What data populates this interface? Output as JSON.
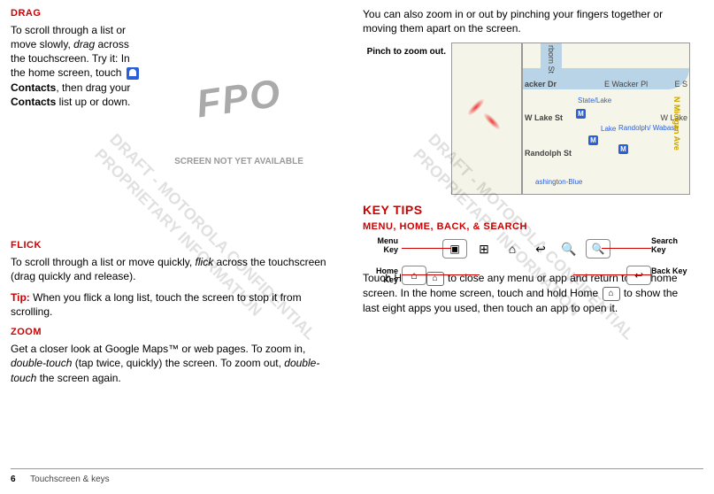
{
  "left": {
    "drag_h": "DRAG",
    "drag_p1a": "To scroll through a list or move slowly, ",
    "drag_p1b": "drag",
    "drag_p1c": " across the touchscreen. Try it: In the home screen, touch ",
    "drag_p1d": "Contacts",
    "drag_p1e": ", then drag your ",
    "drag_p1f": "Contacts",
    "drag_p1g": " list up or down.",
    "fpo": "FPO",
    "fpo_sub": "SCREEN NOT YET AVAILABLE",
    "flick_h": "FLICK",
    "flick_p1a": "To scroll through a list or move quickly, ",
    "flick_p1b": "flick",
    "flick_p1c": " across the touchscreen (drag quickly and release).",
    "tip_label": "Tip:",
    "tip_text": " When you flick a long list, touch the screen to stop it from scrolling.",
    "zoom_h": "ZOOM",
    "zoom_p1a": "Get a closer look at Google Maps™ or web pages. To zoom in, ",
    "zoom_p1b": "double-touch",
    "zoom_p1c": " (tap twice, quickly) the screen. To zoom out, ",
    "zoom_p1d": "double-touch",
    "zoom_p1e": " the screen again."
  },
  "right": {
    "pinch_intro": "You can also zoom in or out by pinching your fingers together or moving them apart on the screen.",
    "pinch_label": "Pinch to zoom out.",
    "keytips_h": "KEY TIPS",
    "sub_h": "MENU, HOME, BACK, & SEARCH",
    "menu_key": "Menu Key",
    "home_key": "Home Key",
    "search_key": "Search Key",
    "back_key": "Back Key",
    "home_p1a": "Touch Home ",
    "home_p1b": " to close any menu or app and return to the home screen. In the home screen, touch and hold Home ",
    "home_p1c": " to show the last eight apps you used, then touch an app to open it."
  },
  "map": {
    "dearborn": "rborn St",
    "wacker_dr": "acker Dr",
    "e_wacker": "E Wacker Pl",
    "e_s": "E S",
    "state_lake": "State/Lake",
    "w_lake": "W Lake St",
    "w_lake2": "W Lake",
    "lake": "Lake",
    "randolph_wabash": "Randolph/ Wabash",
    "randolph": "Randolph St",
    "wash_blue": "ashington-Blue",
    "michigan": "N Micigan Ave"
  },
  "watermarks": {
    "w1": "DRAFT - MOTOROLA CONFIDENTIAL PROPRIETARY INFORMATION",
    "w2": "DRAFT - MOTOROLA CONFIDENTIAL PROPRIETARY INFORMATION"
  },
  "footer": {
    "page": "6",
    "section": "Touchscreen & keys"
  }
}
